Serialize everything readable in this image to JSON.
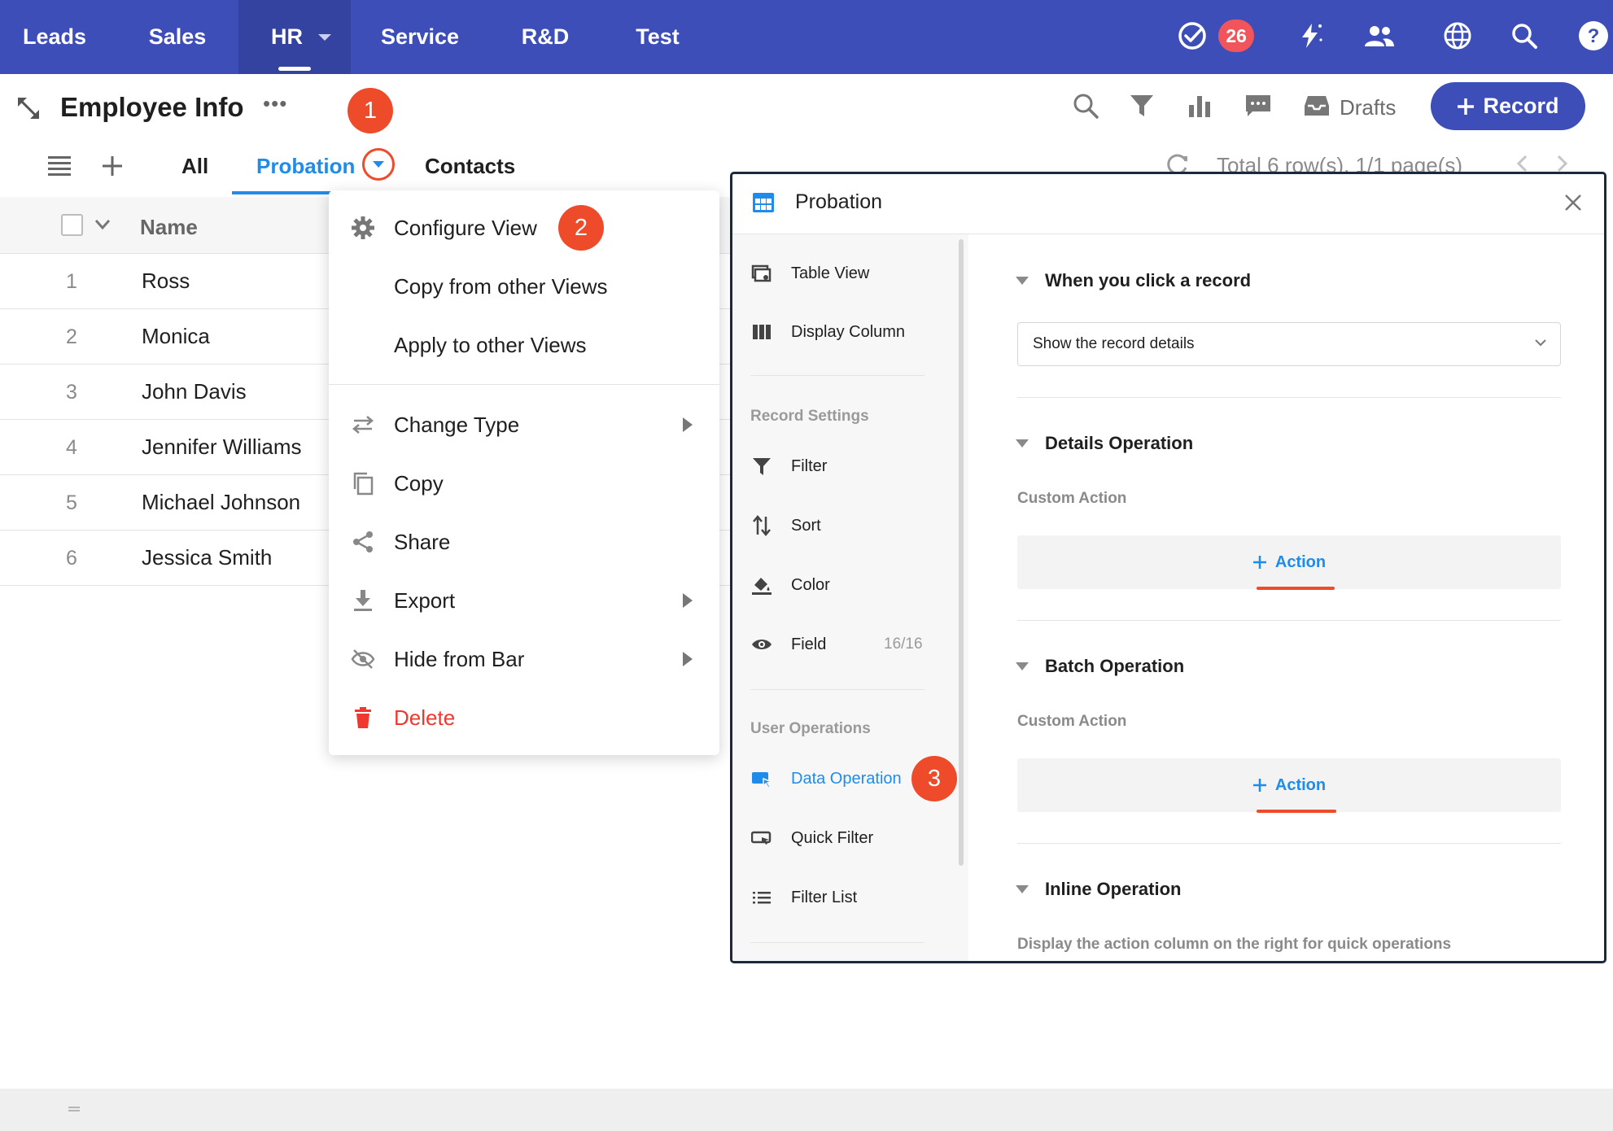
{
  "nav": {
    "tabs": [
      {
        "label": "Leads"
      },
      {
        "label": "Sales"
      },
      {
        "label": "HR"
      },
      {
        "label": "Service"
      },
      {
        "label": "R&D"
      },
      {
        "label": "Test"
      }
    ],
    "active_tab": "HR",
    "todo_count": "26",
    "icons": [
      "todo-check-icon",
      "lightning-icon",
      "contacts-icon",
      "globe-icon",
      "search-icon",
      "help-icon"
    ]
  },
  "header": {
    "title": "Employee Info",
    "more": "•••",
    "drafts_label": "Drafts",
    "record_button": "Record",
    "tools": [
      "search-icon",
      "filter-icon",
      "chart-icon",
      "comment-icon",
      "drafts-icon"
    ]
  },
  "steps": {
    "one": "1",
    "two": "2",
    "three": "3"
  },
  "views": {
    "tabs": [
      {
        "label": "All"
      },
      {
        "label": "Probation"
      },
      {
        "label": "Contacts"
      }
    ],
    "active": "Probation",
    "pagination": "Total 6 row(s), 1/1 page(s)"
  },
  "table": {
    "column_name": "Name",
    "rows": [
      {
        "num": "1",
        "name": "Ross"
      },
      {
        "num": "2",
        "name": "Monica"
      },
      {
        "num": "3",
        "name": "John Davis"
      },
      {
        "num": "4",
        "name": "Jennifer Williams"
      },
      {
        "num": "5",
        "name": "Michael Johnson"
      },
      {
        "num": "6",
        "name": "Jessica Smith"
      }
    ]
  },
  "menu": {
    "items": [
      {
        "label": "Configure View",
        "icon": "gear-icon"
      },
      {
        "label": "Copy from other Views",
        "icon": ""
      },
      {
        "label": "Apply to other Views",
        "icon": ""
      },
      {
        "label": "Change Type",
        "icon": "swap-icon",
        "submenu": true
      },
      {
        "label": "Copy",
        "icon": "copy-icon"
      },
      {
        "label": "Share",
        "icon": "share-icon"
      },
      {
        "label": "Export",
        "icon": "download-icon",
        "submenu": true
      },
      {
        "label": "Hide from Bar",
        "icon": "eye-off-icon",
        "submenu": true
      },
      {
        "label": "Delete",
        "icon": "trash-icon",
        "danger": true
      }
    ]
  },
  "panel": {
    "title": "Probation",
    "sidebar": {
      "items_top": [
        {
          "label": "Table View",
          "icon": "table-view-icon"
        },
        {
          "label": "Display Column",
          "icon": "columns-icon"
        }
      ],
      "record_settings_label": "Record Settings",
      "record_settings": [
        {
          "label": "Filter",
          "icon": "filter-icon"
        },
        {
          "label": "Sort",
          "icon": "sort-icon"
        },
        {
          "label": "Color",
          "icon": "paint-bucket-icon"
        },
        {
          "label": "Field",
          "icon": "eye-icon",
          "count": "16/16"
        }
      ],
      "user_operations_label": "User Operations",
      "user_operations": [
        {
          "label": "Data Operation",
          "icon": "data-operation-icon",
          "active": true
        },
        {
          "label": "Quick Filter",
          "icon": "quick-filter-icon"
        },
        {
          "label": "Filter List",
          "icon": "list-icon"
        }
      ]
    },
    "content": {
      "click_record_title": "When you click a record",
      "click_record_value": "Show the record details",
      "details_title": "Details Operation",
      "details_sub": "Custom Action",
      "details_action": "Action",
      "batch_title": "Batch Operation",
      "batch_sub": "Custom Action",
      "batch_action": "Action",
      "inline_title": "Inline Operation",
      "inline_desc": "Display the action column on the right for quick operations"
    }
  },
  "colors": {
    "nav_bg": "#3d4eb8",
    "accent": "#1f8ceb",
    "step_badge": "#ee4b2b",
    "danger": "#f0382e"
  }
}
